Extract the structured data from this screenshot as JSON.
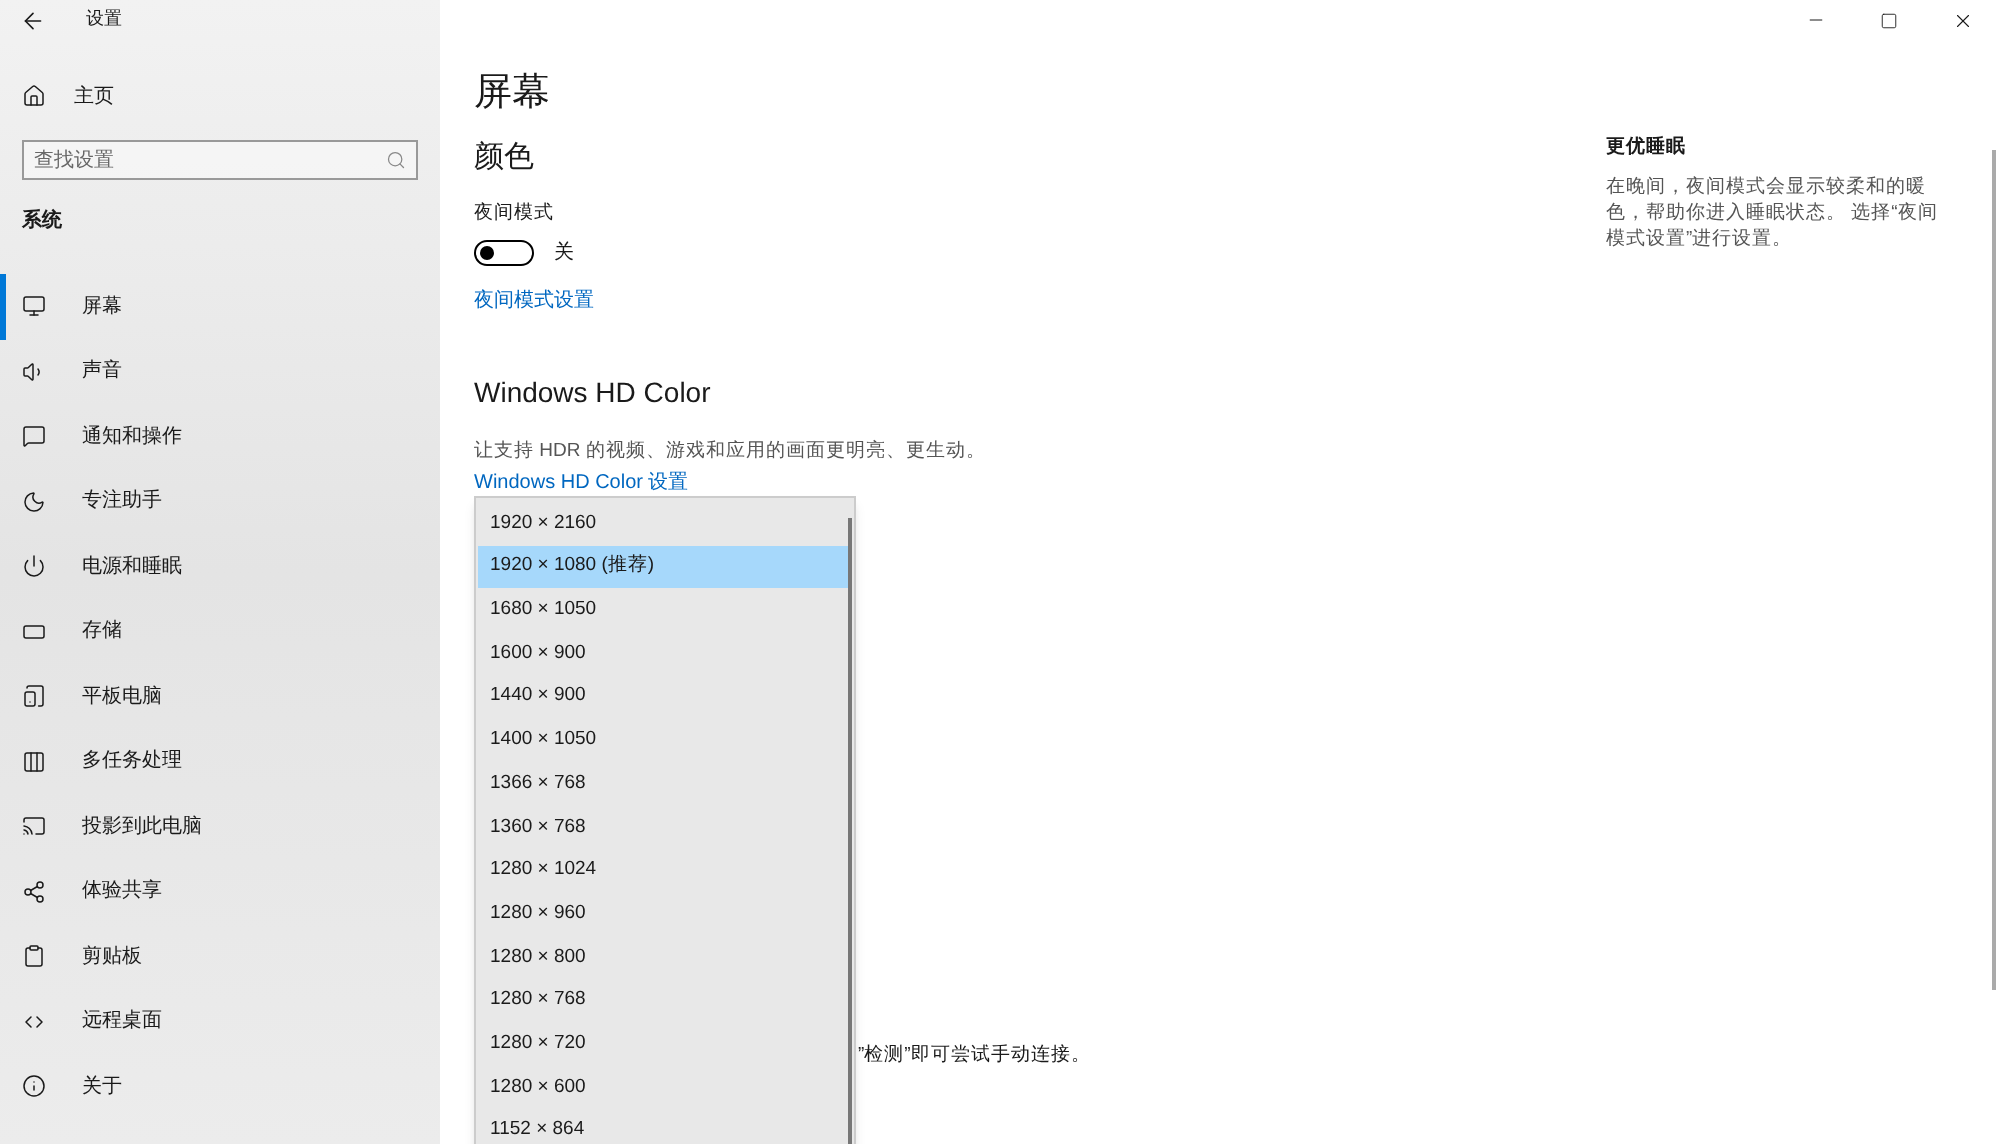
{
  "window": {
    "title": "设置"
  },
  "sidebar": {
    "home": "主页",
    "search": {
      "placeholder": "查找设置"
    },
    "section": "系统",
    "items": [
      {
        "label": "屏幕",
        "selected": true
      },
      {
        "label": "声音",
        "selected": false
      },
      {
        "label": "通知和操作",
        "selected": false
      },
      {
        "label": "专注助手",
        "selected": false
      },
      {
        "label": "电源和睡眠",
        "selected": false
      },
      {
        "label": "存储",
        "selected": false
      },
      {
        "label": "平板电脑",
        "selected": false
      },
      {
        "label": "多任务处理",
        "selected": false
      },
      {
        "label": "投影到此电脑",
        "selected": false
      },
      {
        "label": "体验共享",
        "selected": false
      },
      {
        "label": "剪贴板",
        "selected": false
      },
      {
        "label": "远程桌面",
        "selected": false
      },
      {
        "label": "关于",
        "selected": false
      }
    ]
  },
  "main": {
    "title": "屏幕",
    "color_heading": "颜色",
    "night_mode": {
      "label": "夜间模式",
      "on": false,
      "state_text": "关"
    },
    "night_link": "夜间模式设置",
    "hdr_heading": "Windows HD Color",
    "hdr_desc": "让支持 HDR 的视频、游戏和应用的画面更明亮、更生动。",
    "hdr_link": "Windows HD Color 设置",
    "partial_text": "”检测”即可尝试手动连接。"
  },
  "resolution_dropdown": {
    "options": [
      {
        "label": "1920 × 2160",
        "selected": false
      },
      {
        "label": "1920 × 1080 (推荐)",
        "selected": true
      },
      {
        "label": "1680 × 1050",
        "selected": false
      },
      {
        "label": "1600 × 900",
        "selected": false
      },
      {
        "label": "1440 × 900",
        "selected": false
      },
      {
        "label": "1400 × 1050",
        "selected": false
      },
      {
        "label": "1366 × 768",
        "selected": false
      },
      {
        "label": "1360 × 768",
        "selected": false
      },
      {
        "label": "1280 × 1024",
        "selected": false
      },
      {
        "label": "1280 × 960",
        "selected": false
      },
      {
        "label": "1280 × 800",
        "selected": false
      },
      {
        "label": "1280 × 768",
        "selected": false
      },
      {
        "label": "1280 × 720",
        "selected": false
      },
      {
        "label": "1280 × 600",
        "selected": false
      },
      {
        "label": "1152 × 864",
        "selected": false
      }
    ]
  },
  "side_panel": {
    "title": "更优睡眠",
    "text": "在晚间，夜间模式会显示较柔和的暖色，帮助你进入睡眠状态。 选择“夜间模式设置”进行设置。"
  }
}
